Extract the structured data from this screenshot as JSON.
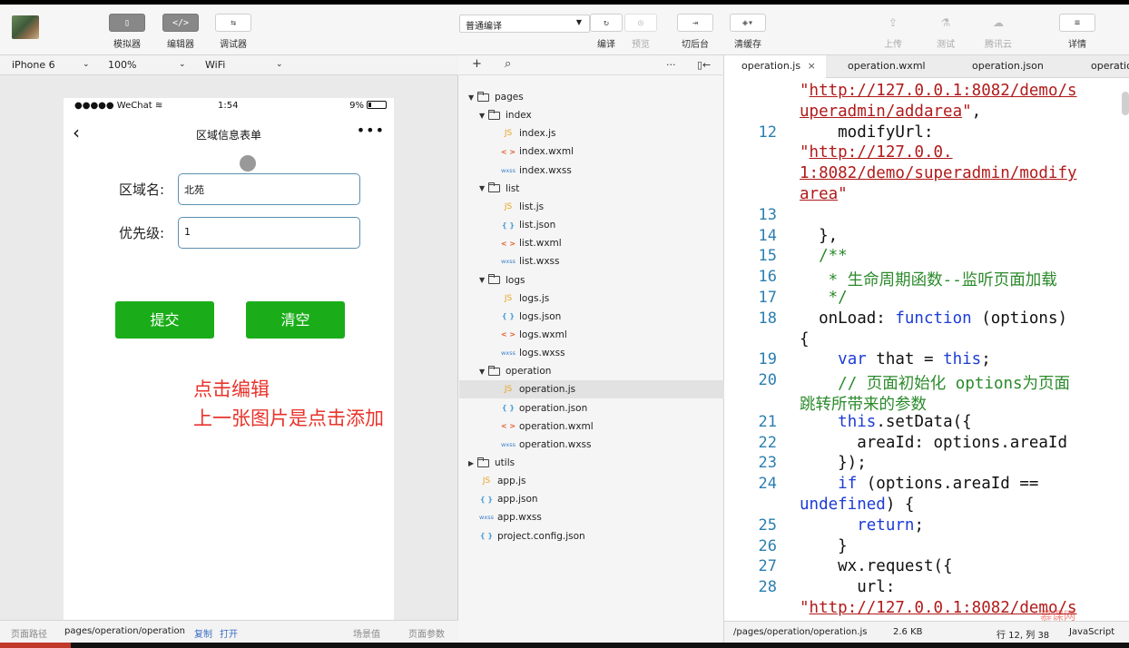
{
  "toolbar": {
    "simulator": "模拟器",
    "editor": "编辑器",
    "debugger": "调试器",
    "compile_mode": "普通编译",
    "compile": "编译",
    "preview": "预览",
    "background": "切后台",
    "clear_cache": "清缓存",
    "upload": "上传",
    "test": "测试",
    "cloud": "腾讯云",
    "details": "详情"
  },
  "simulator": {
    "device": "iPhone 6",
    "zoom": "100%",
    "network": "WiFi",
    "status_left": "●●●●● WeChat",
    "status_time": "1:54",
    "status_battery": "9%",
    "page_title": "区域信息表单",
    "more": "•••",
    "form": {
      "name_label": "区域名:",
      "name_value": "北苑",
      "priority_label": "优先级:",
      "priority_value": "1"
    },
    "submit": "提交",
    "clear": "清空",
    "annotation_line1": "点击编辑",
    "annotation_line2": "上一张图片是点击添加",
    "footer": {
      "path_label": "页面路径",
      "path": "pages/operation/operation",
      "copy": "复制",
      "open": "打开",
      "scene": "场景值",
      "params": "页面参数"
    }
  },
  "tree": {
    "items": [
      {
        "label": "pages",
        "type": "folder",
        "depth": 0,
        "open": true
      },
      {
        "label": "index",
        "type": "folder",
        "depth": 1,
        "open": true
      },
      {
        "label": "index.js",
        "type": "js",
        "depth": 2
      },
      {
        "label": "index.wxml",
        "type": "wxml",
        "depth": 2
      },
      {
        "label": "index.wxss",
        "type": "wxss",
        "depth": 2
      },
      {
        "label": "list",
        "type": "folder",
        "depth": 1,
        "open": true
      },
      {
        "label": "list.js",
        "type": "js",
        "depth": 2
      },
      {
        "label": "list.json",
        "type": "json",
        "depth": 2
      },
      {
        "label": "list.wxml",
        "type": "wxml",
        "depth": 2
      },
      {
        "label": "list.wxss",
        "type": "wxss",
        "depth": 2
      },
      {
        "label": "logs",
        "type": "folder",
        "depth": 1,
        "open": true
      },
      {
        "label": "logs.js",
        "type": "js",
        "depth": 2
      },
      {
        "label": "logs.json",
        "type": "json",
        "depth": 2
      },
      {
        "label": "logs.wxml",
        "type": "wxml",
        "depth": 2
      },
      {
        "label": "logs.wxss",
        "type": "wxss",
        "depth": 2
      },
      {
        "label": "operation",
        "type": "folder",
        "depth": 1,
        "open": true
      },
      {
        "label": "operation.js",
        "type": "js",
        "depth": 2,
        "selected": true
      },
      {
        "label": "operation.json",
        "type": "json",
        "depth": 2
      },
      {
        "label": "operation.wxml",
        "type": "wxml",
        "depth": 2
      },
      {
        "label": "operation.wxss",
        "type": "wxss",
        "depth": 2
      },
      {
        "label": "utils",
        "type": "folder",
        "depth": 0,
        "open": false
      },
      {
        "label": "app.js",
        "type": "js",
        "depth": 0
      },
      {
        "label": "app.json",
        "type": "json",
        "depth": 0
      },
      {
        "label": "app.wxss",
        "type": "wxss",
        "depth": 0
      },
      {
        "label": "project.config.json",
        "type": "json",
        "depth": 0
      }
    ]
  },
  "editor": {
    "tabs": [
      "operation.js",
      "operation.wxml",
      "operation.json",
      "operatio"
    ],
    "lines": [
      {
        "n": "",
        "html": "<span class='q'>\"</span><span class='str'>http://127.0.0.1:8082/demo/s</span>"
      },
      {
        "n": "",
        "html": "<span class='str'>uperadmin/addarea</span><span class='q'>\"</span>,"
      },
      {
        "n": "12",
        "html": "    modifyUrl:"
      },
      {
        "n": "",
        "html": "<span class='q'>\"</span><span class='str'>http://127.0.0.</span>"
      },
      {
        "n": "",
        "html": "<span class='str'>1:8082/demo/superadmin/modify</span>"
      },
      {
        "n": "",
        "html": "<span class='str'>area</span><span class='q'>\"</span>"
      },
      {
        "n": "13",
        "html": ""
      },
      {
        "n": "14",
        "html": "  },"
      },
      {
        "n": "15",
        "html": "  <span class='cm'>/**</span>"
      },
      {
        "n": "16",
        "html": "  <span class='cm'> * 生命周期函数--监听页面加载</span>"
      },
      {
        "n": "17",
        "html": "  <span class='cm'> */</span>"
      },
      {
        "n": "18",
        "html": "  onLoad: <span class='kw'>function</span> (options)"
      },
      {
        "n": "",
        "html": "{"
      },
      {
        "n": "19",
        "html": "    <span class='kw'>var</span> that = <span class='kw'>this</span>;"
      },
      {
        "n": "20",
        "html": "    <span class='cm'>// 页面初始化 options为页面</span>"
      },
      {
        "n": "",
        "html": "<span class='cm'>跳转所带来的参数</span>"
      },
      {
        "n": "21",
        "html": "    <span class='kw'>this</span>.setData({"
      },
      {
        "n": "22",
        "html": "      areaId: options.areaId"
      },
      {
        "n": "23",
        "html": "    });"
      },
      {
        "n": "24",
        "html": "    <span class='kw'>if</span> (options.areaId =="
      },
      {
        "n": "",
        "html": "<span class='kw'>undefined</span>) {"
      },
      {
        "n": "25",
        "html": "      <span class='kw'>return</span>;"
      },
      {
        "n": "26",
        "html": "    }"
      },
      {
        "n": "27",
        "html": "    wx.request({"
      },
      {
        "n": "28",
        "html": "      url:"
      },
      {
        "n": "",
        "html": "<span class='q'>\"</span><span class='str'>http://127.0.0.1:8082/demo/s</span>"
      }
    ],
    "footer": {
      "file": "/pages/operation/operation.js",
      "size": "2.6 KB",
      "position": "行 12, 列 38",
      "lang": "JavaScript"
    }
  }
}
